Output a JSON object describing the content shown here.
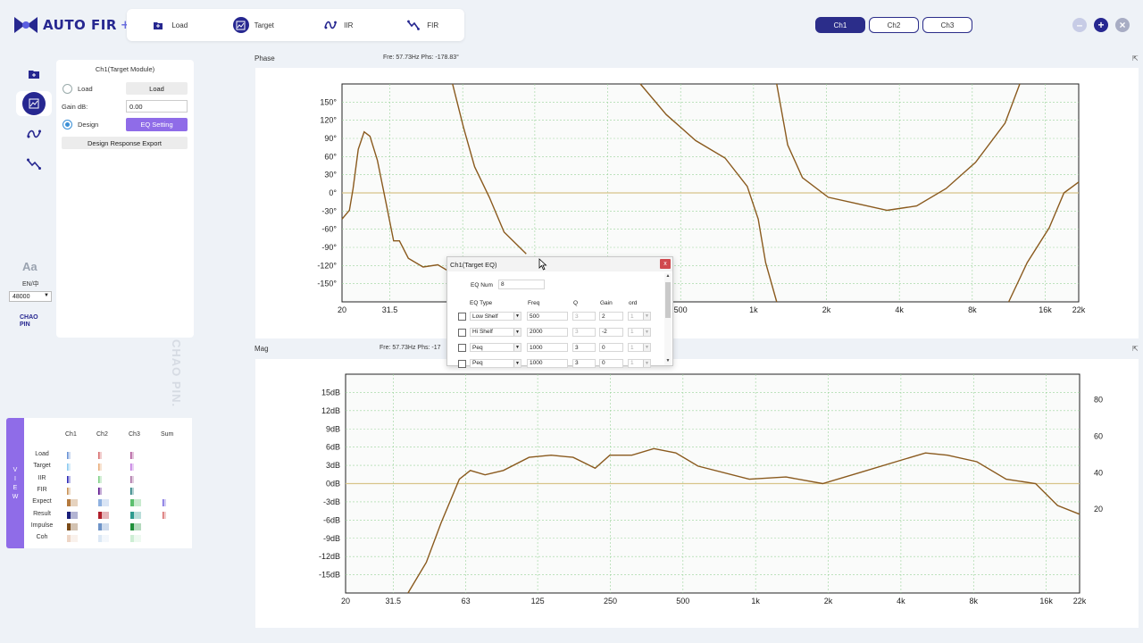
{
  "app": {
    "name": "AUTO FIR",
    "name_suffix": "+"
  },
  "topnav": [
    {
      "label": "Load",
      "icon": "folder-load-icon"
    },
    {
      "label": "Target",
      "icon": "target-chart-icon"
    },
    {
      "label": "IIR",
      "icon": "iir-icon"
    },
    {
      "label": "FIR",
      "icon": "fir-icon"
    }
  ],
  "channels": {
    "tabs": [
      "Ch1",
      "Ch2",
      "Ch3"
    ],
    "active": "Ch1"
  },
  "window": {
    "minimize": "–",
    "add": "+",
    "close": "×"
  },
  "target_panel": {
    "title": "Ch1(Target Module)",
    "load_label": "Load",
    "load_button": "Load",
    "gain_label": "Gain dB:",
    "gain_value": "0.00",
    "design_label": "Design",
    "eq_setting_button": "EQ Setting",
    "export_button": "Design Response Export"
  },
  "lang": {
    "aa": "Aa",
    "en": "EN/中",
    "sample_rate": "48000"
  },
  "brand_small": {
    "line1": "CHAO",
    "line2": "PIN"
  },
  "watermark": "CHAO PIN.",
  "view_tab": [
    "V",
    "I",
    "E",
    "W"
  ],
  "legend": {
    "columns": [
      "Ch1",
      "Ch2",
      "Ch3",
      "Sum"
    ],
    "rows": [
      "Load",
      "Target",
      "IIR",
      "FIR",
      "Expect",
      "Result",
      "Impulse",
      "Coh"
    ],
    "colors": {
      "Ch1": [
        "#6a93d6",
        "#8ccaf0",
        "#2e2bb8",
        "#c99256",
        "#b57a3e",
        "#1a1f7a",
        "#7a4a18",
        "#eed6c6"
      ],
      "Ch2": [
        "#d86e6e",
        "#e9ad7a",
        "#7fd086",
        "#5a0f8a",
        "#8fb1e0",
        "#b01e2a",
        "#6e94c8",
        "#dce8f5"
      ],
      "Ch3": [
        "#b0559a",
        "#c178e0",
        "#a96fa3",
        "#247c7c",
        "#5cbf6e",
        "#2e9b8f",
        "#1f8f3a",
        "#cdeed4"
      ],
      "Sum": [
        null,
        null,
        null,
        null,
        "#7d6ee0",
        "#d86e6e",
        null,
        null
      ]
    }
  },
  "phase_chart": {
    "title": "Phase",
    "readout": "Fre: 57.73Hz   Phs: -178.83°",
    "y_ticks": [
      "150°",
      "120°",
      "90°",
      "60°",
      "30°",
      "0°",
      "-30°",
      "-60°",
      "-90°",
      "-120°",
      "-150°"
    ],
    "x_ticks": [
      "20",
      "31.5",
      "63",
      "125",
      "250",
      "500",
      "1k",
      "2k",
      "4k",
      "8k",
      "16k",
      "22k"
    ]
  },
  "mag_chart": {
    "title": "Mag",
    "readout": "Fre: 57.73Hz   Phs: -17",
    "y_ticks": [
      "15dB",
      "12dB",
      "9dB",
      "6dB",
      "3dB",
      "0dB",
      "-3dB",
      "-6dB",
      "-9dB",
      "-12dB",
      "-15dB"
    ],
    "y2_ticks": [
      "80",
      "60",
      "40",
      "20"
    ],
    "x_ticks": [
      "20",
      "31.5",
      "63",
      "125",
      "250",
      "500",
      "1k",
      "2k",
      "4k",
      "8k",
      "16k",
      "22k"
    ]
  },
  "eq_dialog": {
    "title": "Ch1(Target EQ)",
    "close": "x",
    "eq_num_label": "EQ Num",
    "eq_num_value": "8",
    "headers": [
      "EQ Type",
      "Freq",
      "Q",
      "Gain",
      "ord"
    ],
    "rows": [
      {
        "type": "Low Shelf",
        "freq": "500",
        "q": "3",
        "gain": "2",
        "ord": "1",
        "q_disabled": true
      },
      {
        "type": "Hi Shelf",
        "freq": "2000",
        "q": "3",
        "gain": "-2",
        "ord": "1",
        "q_disabled": true
      },
      {
        "type": "Peq",
        "freq": "1000",
        "q": "3",
        "gain": "0",
        "ord": "1",
        "q_disabled": false
      },
      {
        "type": "Peq",
        "freq": "1000",
        "q": "3",
        "gain": "0",
        "ord": "1",
        "q_disabled": false
      }
    ]
  },
  "colors": {
    "accent": "#2b2d8a",
    "purple_button": "#8f6ce8",
    "curve": "#8a5a1e"
  }
}
